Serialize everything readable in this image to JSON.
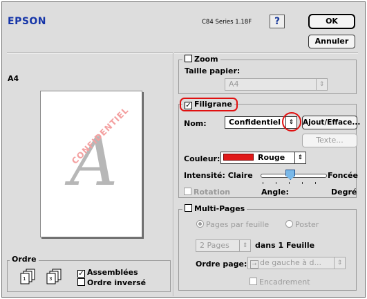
{
  "header": {
    "brand": "EPSON",
    "version": "C84 Series 1.18F",
    "help_label": "?",
    "ok_label": "OK",
    "cancel_label": "Annuler"
  },
  "preview": {
    "paper_label": "A4",
    "watermark_letter": "A",
    "watermark_text": "CONFIDENTIEL"
  },
  "ordre": {
    "title": "Ordre",
    "assemblees_label": "Assemblées",
    "assemblees_checked": true,
    "inverse_label": "Ordre inversé",
    "inverse_checked": false
  },
  "zoom": {
    "label": "Zoom",
    "checked": false,
    "paper_size_label": "Taille papier:",
    "paper_size_value": "A4"
  },
  "filigrane": {
    "label": "Filigrane",
    "checked": true,
    "name_label": "Nom:",
    "name_value": "Confidentiel",
    "add_delete_label": "Ajout/Efface...",
    "text_button_label": "Texte...",
    "color_label": "Couleur:",
    "color_value": "Rouge",
    "color_swatch": "#e01818",
    "intensity_label": "Intensité:",
    "intensity_min": "Claire",
    "intensity_max": "Foncée",
    "intensity_level": 0.45,
    "rotation_label": "Rotation",
    "angle_label": "Angle:",
    "degree_label": "Degré"
  },
  "multipages": {
    "label": "Multi-Pages",
    "checked": false,
    "option_pages_par_feuille": "Pages par feuille",
    "option_poster": "Poster",
    "pages_value": "2 Pages",
    "per_sheet_label": "dans 1 Feuille",
    "order_label": "Ordre page:",
    "order_value": "de gauche à d...",
    "border_label": "Encadrement"
  }
}
